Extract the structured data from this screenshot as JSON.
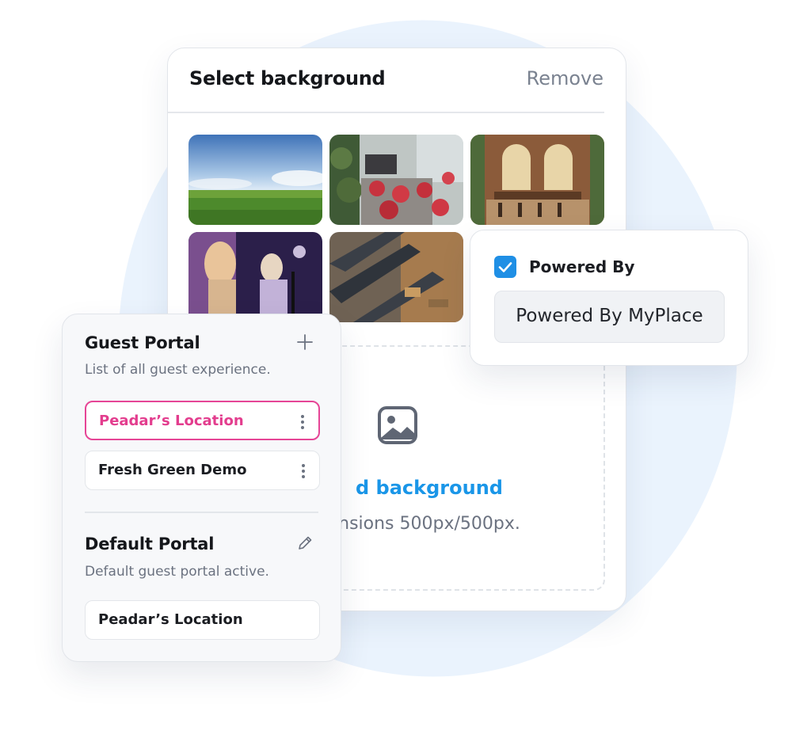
{
  "background_panel": {
    "title": "Select background",
    "remove_label": "Remove",
    "thumbnails": [
      {
        "name": "green-field"
      },
      {
        "name": "cafe-terrace"
      },
      {
        "name": "restaurant-bar"
      },
      {
        "name": "concert-stage"
      },
      {
        "name": "mall-escalators"
      }
    ],
    "upload": {
      "title": "d background",
      "subtitle": "nsions 500px/500px."
    }
  },
  "powered_by": {
    "label": "Powered By",
    "checked": true,
    "value": "Powered By MyPlace"
  },
  "guest_portal": {
    "title": "Guest Portal",
    "description": "List of all guest experience.",
    "items": [
      {
        "label": "Peadar’s Location",
        "selected": true
      },
      {
        "label": "Fresh Green Demo",
        "selected": false
      }
    ]
  },
  "default_portal": {
    "title": "Default Portal",
    "description": "Default guest portal active.",
    "value": "Peadar’s Location"
  },
  "colors": {
    "accent_blue": "#1a96e8",
    "accent_pink": "#e33d8e",
    "blob": "#eaf3fd"
  }
}
